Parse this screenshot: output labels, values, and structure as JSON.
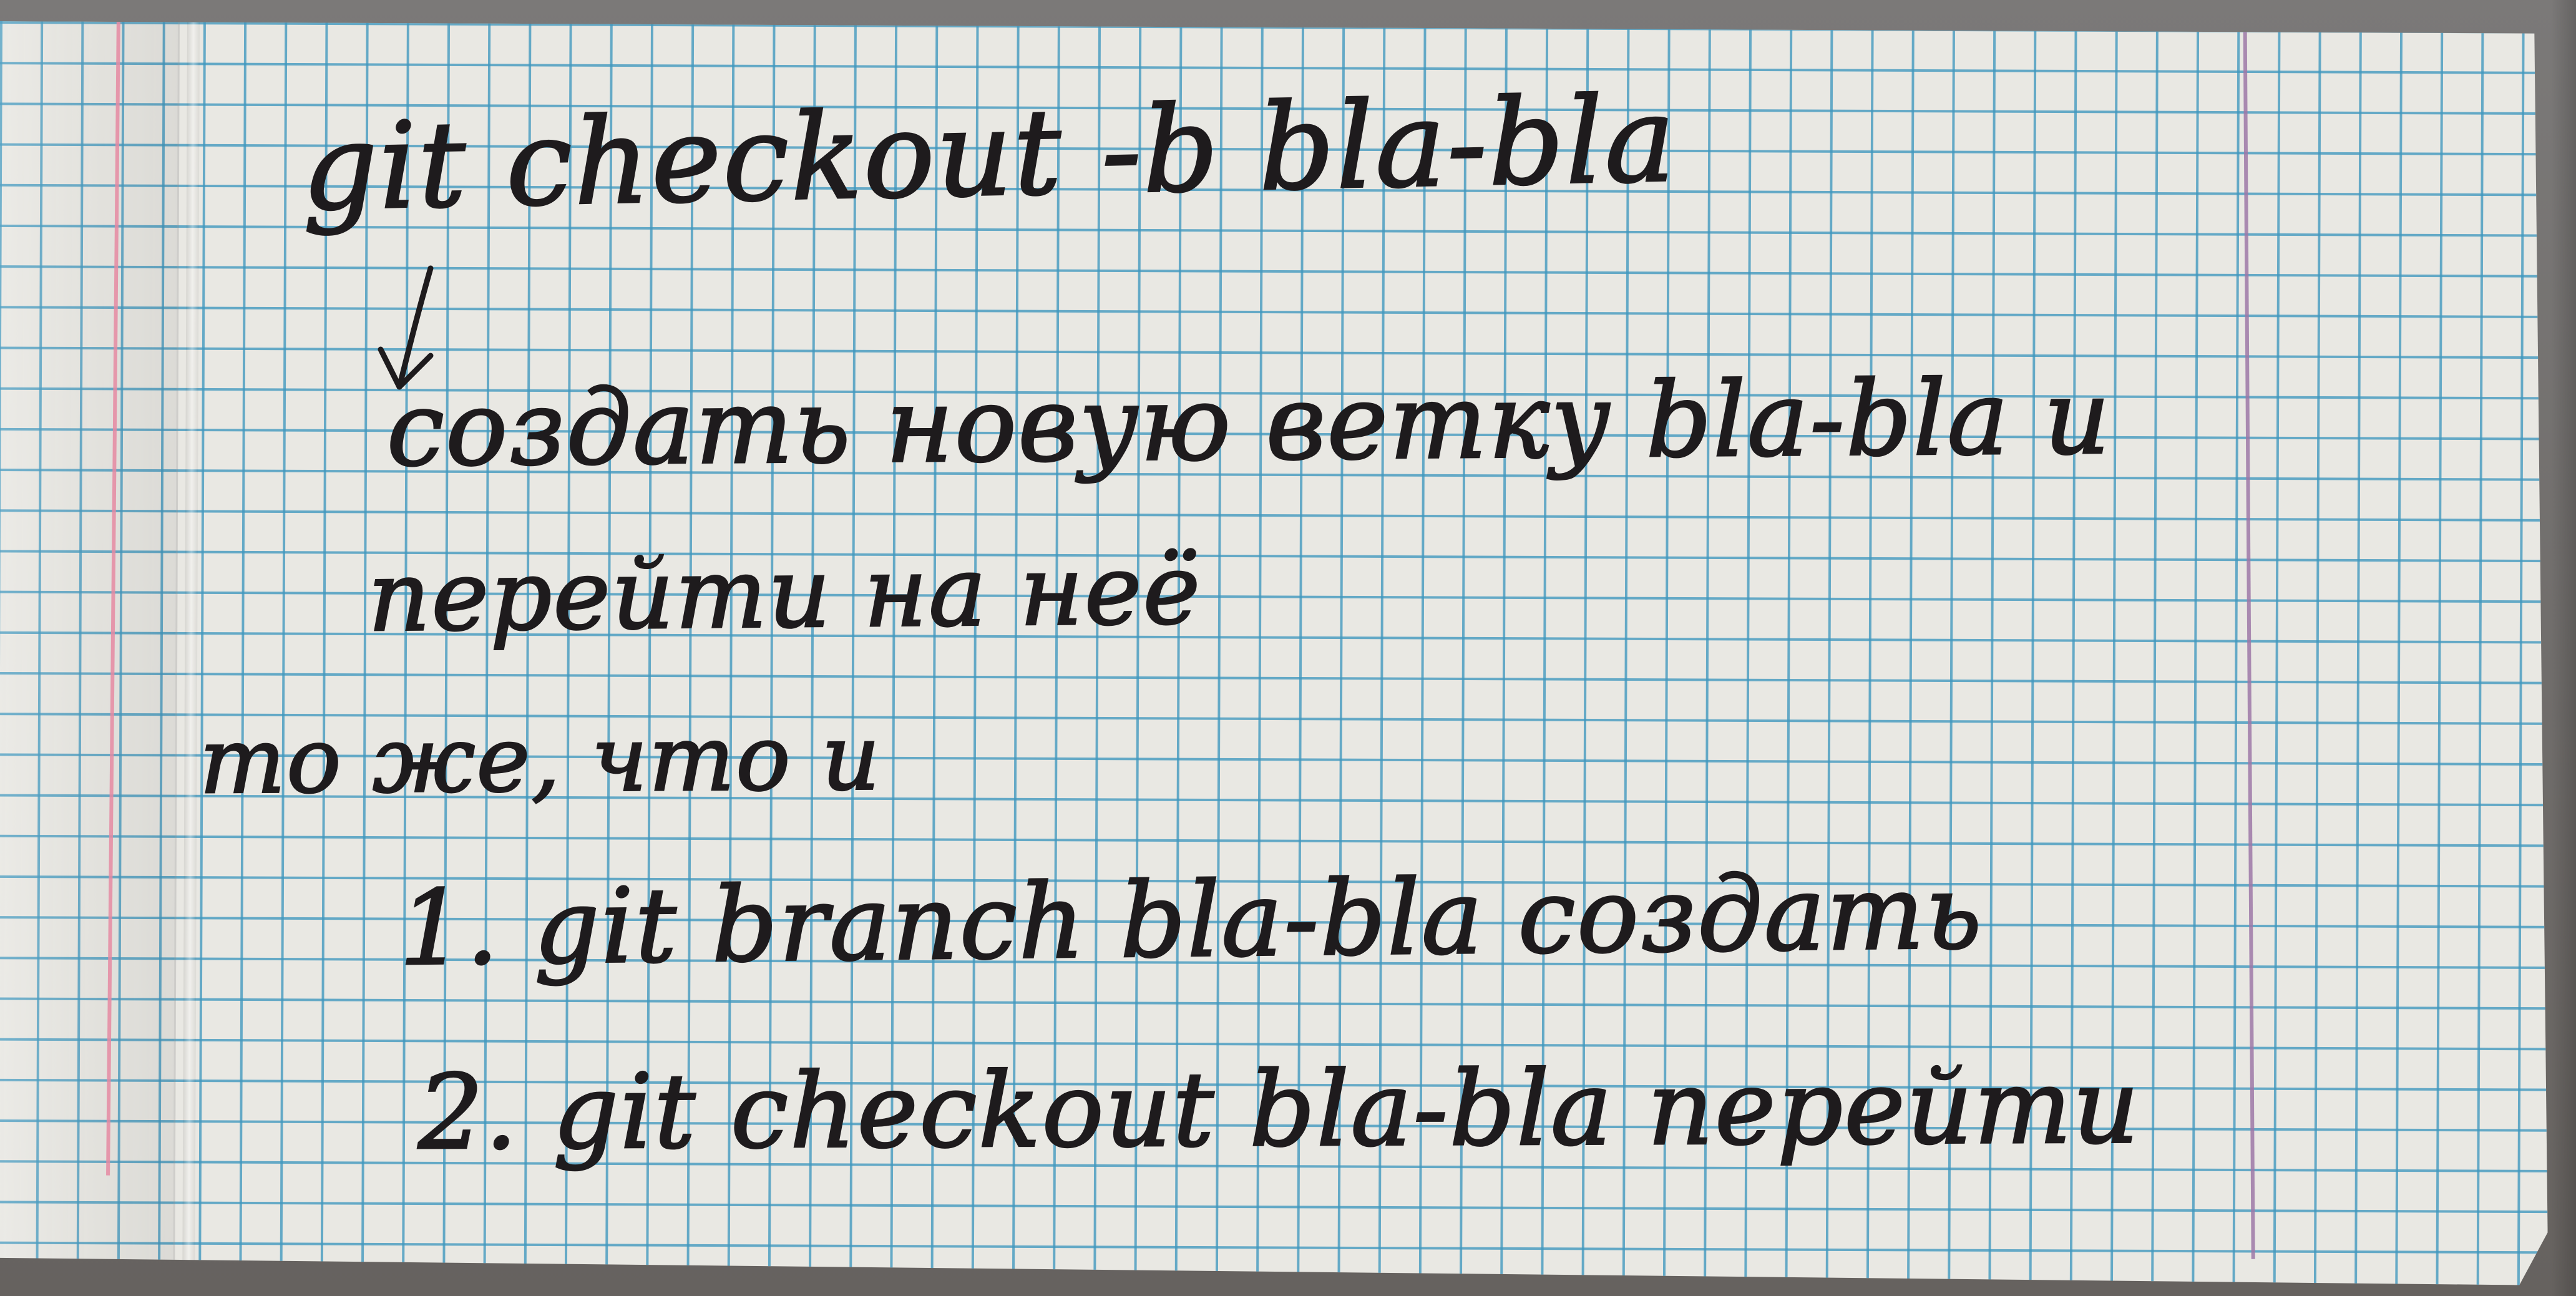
{
  "note": {
    "line_1": "git checkout -b bla-bla",
    "line_2": "создать новую ветку bla-bla и",
    "line_3": "перейти на неё",
    "line_4": "то же, что и",
    "line_5": "1. git branch bla-bla создать",
    "line_6": "2. git checkout bla-bla перейти"
  },
  "colors": {
    "paper": "#e9e8e3",
    "grid": "#3f97be",
    "ink": "#1e1b1d",
    "left_margin": "#e58aa2",
    "right_margin": "#9d78a7"
  },
  "icon_names": {
    "arrow": "arrow-down-icon"
  }
}
